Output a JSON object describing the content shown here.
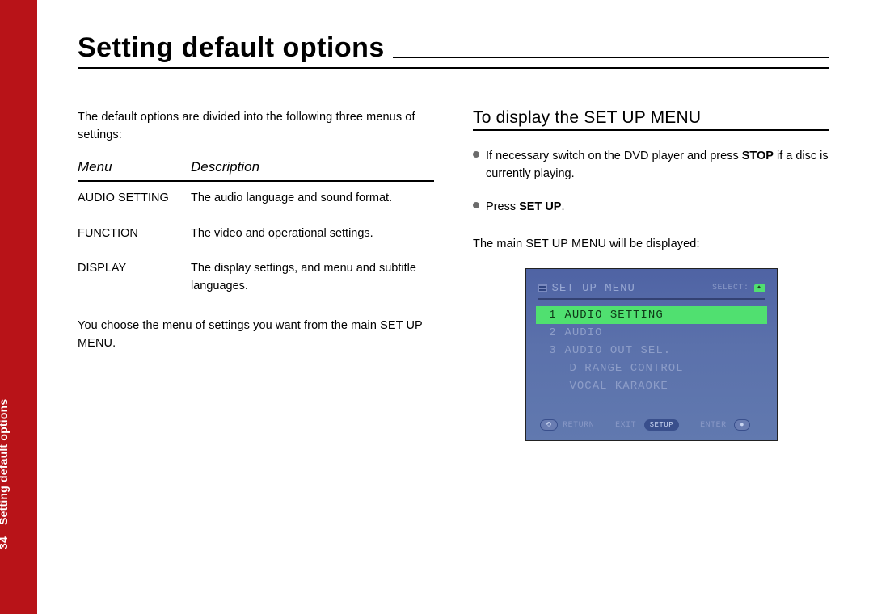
{
  "page_number": "34",
  "side_label": "Setting default options",
  "title": "Setting default options",
  "left": {
    "intro": "The default options are divided into the following three menus of settings:",
    "headers": {
      "menu": "Menu",
      "desc": "Description"
    },
    "rows": [
      {
        "menu": "AUDIO SETTING",
        "desc": "The audio language and sound format."
      },
      {
        "menu": "FUNCTION",
        "desc": "The video and operational settings."
      },
      {
        "menu": "DISPLAY",
        "desc": "The display settings, and menu and subtitle languages."
      }
    ],
    "outro": "You choose the menu of settings you want from the main SET UP MENU."
  },
  "right": {
    "heading": "To display the SET UP MENU",
    "step1_a": "If necessary switch on the DVD player and press ",
    "step1_b": "STOP",
    "step1_c": " if a disc is currently playing.",
    "step2_a": "Press ",
    "step2_b": "SET UP",
    "step2_c": ".",
    "result": "The main SET UP MENU will be displayed:"
  },
  "tv": {
    "title": "SET UP MENU",
    "select_label": "SELECT:",
    "items": [
      {
        "num": "1",
        "label": "AUDIO SETTING",
        "selected": true
      },
      {
        "num": "2",
        "label": "AUDIO"
      },
      {
        "num": "3",
        "label": "AUDIO OUT SEL."
      },
      {
        "num": "",
        "label": "D RANGE CONTROL"
      },
      {
        "num": "",
        "label": "VOCAL KARAOKE"
      }
    ],
    "footer": {
      "return": "RETURN",
      "exit": "EXIT",
      "setup": "SETUP",
      "enter": "ENTER"
    }
  }
}
